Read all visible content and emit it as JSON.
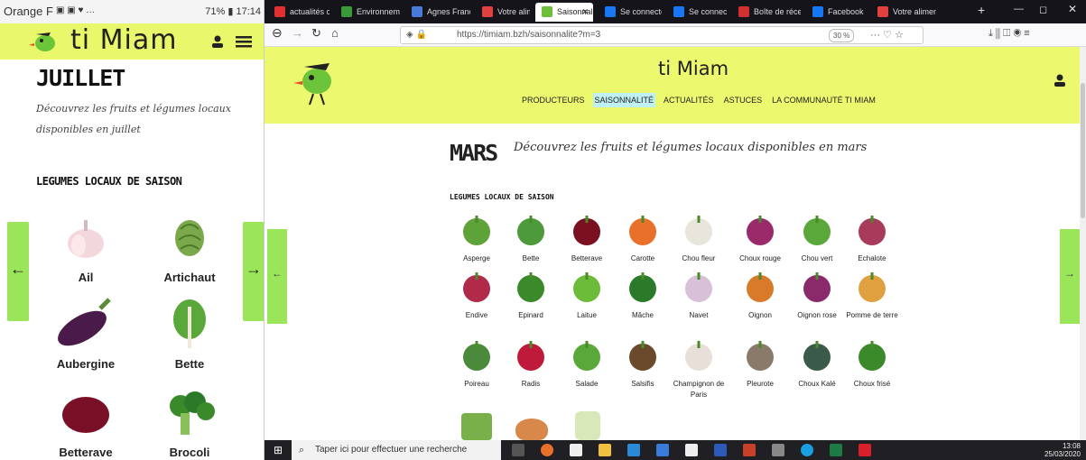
{
  "phone": {
    "status": {
      "carrier": "Orange F",
      "battery": "71%",
      "time": "17:14"
    },
    "logo": "ti Miam",
    "month_title": "JUILLET",
    "subtitle": "Découvrez les fruits et légumes locaux disponibles en juillet",
    "section": "LEGUMES LOCAUX DE SAISON",
    "items": [
      {
        "label": "Ail",
        "icon": "garlic-icon"
      },
      {
        "label": "Artichaut",
        "icon": "artichoke-icon"
      },
      {
        "label": "Aubergine",
        "icon": "eggplant-icon"
      },
      {
        "label": "Bette",
        "icon": "chard-icon"
      },
      {
        "label": "Betterave",
        "icon": "beet-icon"
      },
      {
        "label": "Brocoli",
        "icon": "broccoli-icon"
      }
    ]
  },
  "browser": {
    "tabs": [
      {
        "label": "actualités co",
        "color": "#e03030"
      },
      {
        "label": "Environneme",
        "color": "#3a9a3a"
      },
      {
        "label": "Agnes Franco",
        "color": "#4a7ad8"
      },
      {
        "label": "Votre aliment",
        "color": "#e04040"
      },
      {
        "label": "Saisonnalit",
        "color": "#6bbf3a"
      },
      {
        "label": "Se connecter",
        "color": "#1877f2"
      },
      {
        "label": "Se connecter",
        "color": "#1877f2"
      },
      {
        "label": "Boîte de récep",
        "color": "#d03030"
      },
      {
        "label": "Facebook",
        "color": "#1877f2"
      },
      {
        "label": "Votre aliment",
        "color": "#e04040"
      }
    ],
    "url": "https://timiam.bzh/saisonnalite?m=3",
    "zoom": "30 %",
    "site": {
      "logo": "ti Miam",
      "nav": [
        "PRODUCTEURS",
        "SAISONNALITÉ",
        "ACTUALITÉS",
        "ASTUCES",
        "LA COMMUNAUTÉ TI MIAM"
      ],
      "month_title": "MARS",
      "subtitle": "Découvrez les fruits et légumes locaux disponibles en mars",
      "section": "LEGUMES LOCAUX DE SAISON",
      "vegetables": [
        {
          "label": "Asperge",
          "color": "#5ea23a"
        },
        {
          "label": "Bette",
          "color": "#4c9a3a"
        },
        {
          "label": "Betterave",
          "color": "#7a1020"
        },
        {
          "label": "Carotte",
          "color": "#e8702a"
        },
        {
          "label": "Chou fleur",
          "color": "#e8e6dc"
        },
        {
          "label": "Choux rouge",
          "color": "#9a2a6a"
        },
        {
          "label": "Chou vert",
          "color": "#5aa83a"
        },
        {
          "label": "Echalote",
          "color": "#a83a5a"
        },
        {
          "label": "Endive",
          "color": "#b02a4a"
        },
        {
          "label": "Epinard",
          "color": "#3a8a2a"
        },
        {
          "label": "Laitue",
          "color": "#6cbc3a"
        },
        {
          "label": "Mâche",
          "color": "#2a7a2a"
        },
        {
          "label": "Navet",
          "color": "#d8c0d8"
        },
        {
          "label": "Oignon",
          "color": "#d87a2a"
        },
        {
          "label": "Oignon rose",
          "color": "#8a2a6a"
        },
        {
          "label": "Pomme de terre",
          "color": "#e0a040"
        },
        {
          "label": "Poireau",
          "color": "#4a8a3a"
        },
        {
          "label": "Radis",
          "color": "#c01a3a"
        },
        {
          "label": "Salade",
          "color": "#5aa83a"
        },
        {
          "label": "Salsifis",
          "color": "#6a4a2a"
        },
        {
          "label": "Champignon de Paris",
          "color": "#e8e0d8"
        },
        {
          "label": "Pleurote",
          "color": "#8a7a6a"
        },
        {
          "label": "Choux Kalé",
          "color": "#3a5a4a"
        },
        {
          "label": "Choux frisé",
          "color": "#3a8a2a"
        }
      ]
    },
    "taskbar": {
      "search_placeholder": "Taper ici pour effectuer une recherche",
      "time": "13:08",
      "date": "25/03/2020"
    }
  }
}
